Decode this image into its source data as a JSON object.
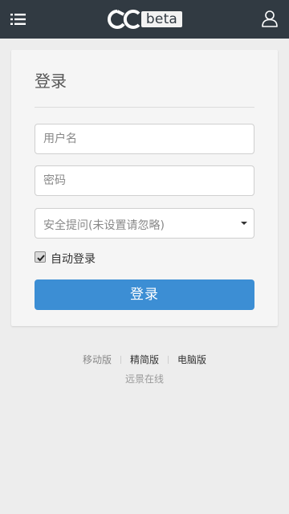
{
  "header": {
    "menu_icon": "list-menu-icon",
    "logo_badge": "beta",
    "user_icon": "user-icon"
  },
  "login": {
    "title": "登录",
    "username_placeholder": "用户名",
    "password_placeholder": "密码",
    "security_question": "安全提问(未设置请忽略)",
    "remember_label": "自动登录",
    "remember_checked": true,
    "submit_label": "登录"
  },
  "footer": {
    "links": [
      "移动版",
      "精简版",
      "电脑版"
    ],
    "brand": "远景在线"
  },
  "colors": {
    "topbar": "#313a42",
    "accent": "#3c8ed4",
    "background": "#ededed",
    "panel": "#f5f5f5"
  }
}
